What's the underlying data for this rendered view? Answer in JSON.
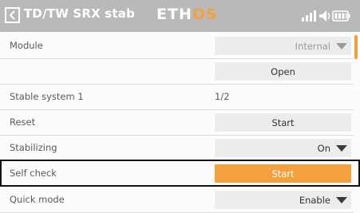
{
  "header": {
    "title": "TD/TW SRX stab",
    "logo_eth": "ETH",
    "logo_os": "OS",
    "icons": [
      "back-arrow-icon",
      "signal-strength-icon",
      "volume-icon",
      "battery-icon"
    ]
  },
  "rows": [
    {
      "label": "Module",
      "control": "select",
      "value": "Internal",
      "enabled": false
    },
    {
      "label": "",
      "control": "button",
      "value": "Open"
    },
    {
      "label": "Stable system 1",
      "control": "text",
      "value": "1/2"
    },
    {
      "label": "Reset",
      "control": "button",
      "value": "Start"
    },
    {
      "label": "Stabilizing",
      "control": "select",
      "value": "On"
    },
    {
      "label": "Self check",
      "control": "button",
      "value": "Start",
      "focused": true
    },
    {
      "label": "Quick mode",
      "control": "select",
      "value": "Enable"
    }
  ],
  "colors": {
    "accent": "#f3a13f",
    "header": "#b9b9b9",
    "field": "#ececec"
  }
}
